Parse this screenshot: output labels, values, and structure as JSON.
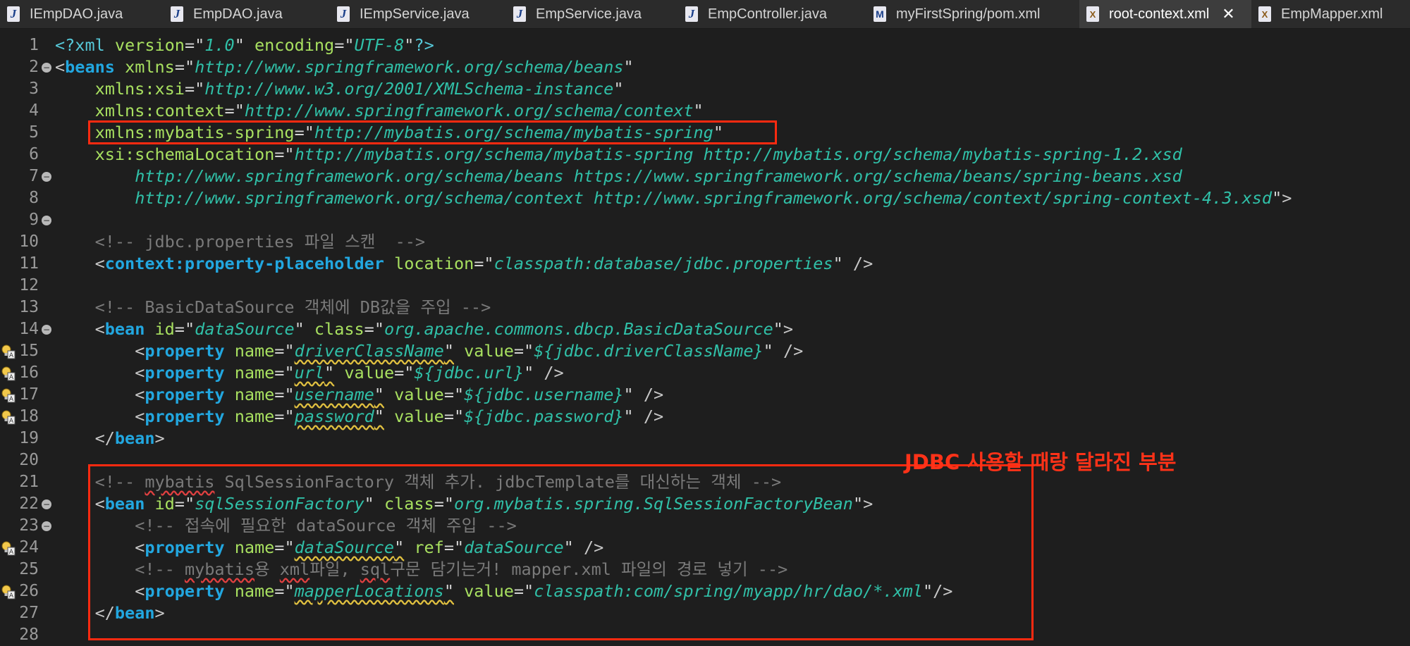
{
  "tabs": [
    {
      "label": "IEmpDAO.java",
      "icon": "java-file-icon",
      "active": false
    },
    {
      "label": "EmpDAO.java",
      "icon": "java-file-icon",
      "active": false
    },
    {
      "label": "IEmpService.java",
      "icon": "java-file-icon",
      "active": false
    },
    {
      "label": "EmpService.java",
      "icon": "java-file-icon",
      "active": false
    },
    {
      "label": "EmpController.java",
      "icon": "java-file-icon",
      "active": false
    },
    {
      "label": "myFirstSpring/pom.xml",
      "icon": "maven-file-icon",
      "active": false
    },
    {
      "label": "root-context.xml",
      "icon": "xml-file-icon",
      "active": true
    },
    {
      "label": "EmpMapper.xml",
      "icon": "xml-file-icon",
      "active": false
    }
  ],
  "annotation": "JDBC 사용할 때랑 달라진 부분",
  "colors": {
    "highlight_box": "#ff2a10",
    "annotation_text": "#ff3218",
    "editor_background": "#1e1e1e",
    "tag": "#22a7e0",
    "attribute": "#a8e060",
    "string": "#30c0a8",
    "comment": "#7a7a7a"
  },
  "lines": [
    {
      "num": "1",
      "fold": false,
      "warn": false,
      "tokens": [
        [
          "pi",
          "<?xml "
        ],
        [
          "attr",
          "version"
        ],
        [
          "eq",
          "="
        ],
        [
          "q",
          "\""
        ],
        [
          "str",
          "1.0"
        ],
        [
          "q",
          "\""
        ],
        [
          "t",
          " "
        ],
        [
          "attr",
          "encoding"
        ],
        [
          "eq",
          "="
        ],
        [
          "q",
          "\""
        ],
        [
          "str",
          "UTF-8"
        ],
        [
          "q",
          "\""
        ],
        [
          "pi",
          "?>"
        ]
      ]
    },
    {
      "num": "2",
      "fold": true,
      "warn": false,
      "tokens": [
        [
          "punct",
          "<"
        ],
        [
          "tag",
          "beans"
        ],
        [
          "t",
          " "
        ],
        [
          "attr",
          "xmlns"
        ],
        [
          "eq",
          "="
        ],
        [
          "q",
          "\""
        ],
        [
          "str",
          "http://www.springframework.org/schema/beans"
        ],
        [
          "q",
          "\""
        ]
      ]
    },
    {
      "num": "3",
      "fold": false,
      "warn": false,
      "tokens": [
        [
          "t",
          "    "
        ],
        [
          "attr",
          "xmlns:xsi"
        ],
        [
          "eq",
          "="
        ],
        [
          "q",
          "\""
        ],
        [
          "str",
          "http://www.w3.org/2001/XMLSchema-instance"
        ],
        [
          "q",
          "\""
        ]
      ]
    },
    {
      "num": "4",
      "fold": false,
      "warn": false,
      "tokens": [
        [
          "t",
          "    "
        ],
        [
          "attr",
          "xmlns:context"
        ],
        [
          "eq",
          "="
        ],
        [
          "q",
          "\""
        ],
        [
          "str",
          "http://www.springframework.org/schema/context"
        ],
        [
          "q",
          "\""
        ]
      ]
    },
    {
      "num": "5",
      "fold": false,
      "warn": false,
      "tokens": [
        [
          "t",
          "    "
        ],
        [
          "attr",
          "xmlns:mybatis-spring"
        ],
        [
          "eq",
          "="
        ],
        [
          "q",
          "\""
        ],
        [
          "str",
          "http://mybatis.org/schema/mybatis-spring"
        ],
        [
          "q",
          "\""
        ]
      ]
    },
    {
      "num": "6",
      "fold": false,
      "warn": false,
      "tokens": [
        [
          "t",
          "    "
        ],
        [
          "attr",
          "xsi:schemaLocation"
        ],
        [
          "eq",
          "="
        ],
        [
          "q",
          "\""
        ],
        [
          "str",
          "http://mybatis.org/schema/mybatis-spring http://mybatis.org/schema/mybatis-spring-1.2.xsd"
        ]
      ]
    },
    {
      "num": "7",
      "fold": true,
      "warn": false,
      "tokens": [
        [
          "t",
          "        "
        ],
        [
          "str",
          "http://www.springframework.org/schema/beans https://www.springframework.org/schema/beans/spring-beans.xsd"
        ]
      ]
    },
    {
      "num": "8",
      "fold": false,
      "warn": false,
      "tokens": [
        [
          "t",
          "        "
        ],
        [
          "str",
          "http://www.springframework.org/schema/context http://www.springframework.org/schema/context/spring-context-4.3.xsd"
        ],
        [
          "q",
          "\""
        ],
        [
          "punct",
          ">"
        ]
      ]
    },
    {
      "num": "9",
      "fold": true,
      "warn": false,
      "tokens": []
    },
    {
      "num": "10",
      "fold": false,
      "warn": false,
      "tokens": [
        [
          "t",
          "    "
        ],
        [
          "cmt",
          "<!-- jdbc.properties 파일 스캔  -->"
        ]
      ]
    },
    {
      "num": "11",
      "fold": false,
      "warn": false,
      "tokens": [
        [
          "t",
          "    "
        ],
        [
          "punct",
          "<"
        ],
        [
          "tag",
          "context:property-placeholder"
        ],
        [
          "t",
          " "
        ],
        [
          "attr",
          "location"
        ],
        [
          "eq",
          "="
        ],
        [
          "q",
          "\""
        ],
        [
          "str",
          "classpath:database/jdbc.properties"
        ],
        [
          "q",
          "\""
        ],
        [
          "t",
          " "
        ],
        [
          "punct",
          "/>"
        ]
      ]
    },
    {
      "num": "12",
      "fold": false,
      "warn": false,
      "tokens": []
    },
    {
      "num": "13",
      "fold": false,
      "warn": false,
      "tokens": [
        [
          "t",
          "    "
        ],
        [
          "cmt",
          "<!-- BasicDataSource 객체에 DB값을 주입 -->"
        ]
      ]
    },
    {
      "num": "14",
      "fold": true,
      "warn": false,
      "tokens": [
        [
          "t",
          "    "
        ],
        [
          "punct",
          "<"
        ],
        [
          "tag",
          "bean"
        ],
        [
          "t",
          " "
        ],
        [
          "attr",
          "id"
        ],
        [
          "eq",
          "="
        ],
        [
          "q",
          "\""
        ],
        [
          "str",
          "dataSource"
        ],
        [
          "q",
          "\""
        ],
        [
          "t",
          " "
        ],
        [
          "attr",
          "class"
        ],
        [
          "eq",
          "="
        ],
        [
          "q",
          "\""
        ],
        [
          "str",
          "org.apache.commons.dbcp.BasicDataSource"
        ],
        [
          "q",
          "\""
        ],
        [
          "punct",
          ">"
        ]
      ]
    },
    {
      "num": "15",
      "fold": false,
      "warn": true,
      "tokens": [
        [
          "t",
          "        "
        ],
        [
          "punct",
          "<"
        ],
        [
          "tag",
          "property"
        ],
        [
          "t",
          " "
        ],
        [
          "attr",
          "name"
        ],
        [
          "eq",
          "="
        ],
        [
          "q",
          "\""
        ],
        [
          "strU",
          "driverClassName"
        ],
        [
          "qU",
          "\""
        ],
        [
          "t",
          " "
        ],
        [
          "attr",
          "value"
        ],
        [
          "eq",
          "="
        ],
        [
          "q",
          "\""
        ],
        [
          "str",
          "${jdbc.driverClassName}"
        ],
        [
          "q",
          "\""
        ],
        [
          "t",
          " "
        ],
        [
          "punct",
          "/>"
        ]
      ]
    },
    {
      "num": "16",
      "fold": false,
      "warn": true,
      "tokens": [
        [
          "t",
          "        "
        ],
        [
          "punct",
          "<"
        ],
        [
          "tag",
          "property"
        ],
        [
          "t",
          " "
        ],
        [
          "attr",
          "name"
        ],
        [
          "eq",
          "="
        ],
        [
          "q",
          "\""
        ],
        [
          "strU",
          "url"
        ],
        [
          "qU",
          "\""
        ],
        [
          "t",
          " "
        ],
        [
          "attr",
          "value"
        ],
        [
          "eq",
          "="
        ],
        [
          "q",
          "\""
        ],
        [
          "str",
          "${jdbc.url}"
        ],
        [
          "q",
          "\""
        ],
        [
          "t",
          " "
        ],
        [
          "punct",
          "/>"
        ]
      ]
    },
    {
      "num": "17",
      "fold": false,
      "warn": true,
      "tokens": [
        [
          "t",
          "        "
        ],
        [
          "punct",
          "<"
        ],
        [
          "tag",
          "property"
        ],
        [
          "t",
          " "
        ],
        [
          "attr",
          "name"
        ],
        [
          "eq",
          "="
        ],
        [
          "q",
          "\""
        ],
        [
          "strU",
          "username"
        ],
        [
          "qU",
          "\""
        ],
        [
          "t",
          " "
        ],
        [
          "attr",
          "value"
        ],
        [
          "eq",
          "="
        ],
        [
          "q",
          "\""
        ],
        [
          "str",
          "${jdbc.username}"
        ],
        [
          "q",
          "\""
        ],
        [
          "t",
          " "
        ],
        [
          "punct",
          "/>"
        ]
      ]
    },
    {
      "num": "18",
      "fold": false,
      "warn": true,
      "tokens": [
        [
          "t",
          "        "
        ],
        [
          "punct",
          "<"
        ],
        [
          "tag",
          "property"
        ],
        [
          "t",
          " "
        ],
        [
          "attr",
          "name"
        ],
        [
          "eq",
          "="
        ],
        [
          "q",
          "\""
        ],
        [
          "strU",
          "password"
        ],
        [
          "qU",
          "\""
        ],
        [
          "t",
          " "
        ],
        [
          "attr",
          "value"
        ],
        [
          "eq",
          "="
        ],
        [
          "q",
          "\""
        ],
        [
          "str",
          "${jdbc.password}"
        ],
        [
          "q",
          "\""
        ],
        [
          "t",
          " "
        ],
        [
          "punct",
          "/>"
        ]
      ]
    },
    {
      "num": "19",
      "fold": false,
      "warn": false,
      "tokens": [
        [
          "t",
          "    "
        ],
        [
          "punct",
          "</"
        ],
        [
          "tag",
          "bean"
        ],
        [
          "punct",
          ">"
        ]
      ]
    },
    {
      "num": "20",
      "fold": false,
      "warn": false,
      "tokens": []
    },
    {
      "num": "21",
      "fold": false,
      "warn": false,
      "tokens": [
        [
          "t",
          "    "
        ],
        [
          "cmt",
          "<!-- "
        ],
        [
          "cmtS",
          "mybatis"
        ],
        [
          "cmt",
          " SqlSessionFactory 객체 추가. jdbcTemplate를 대신하는 객체 -->"
        ]
      ]
    },
    {
      "num": "22",
      "fold": true,
      "warn": false,
      "tokens": [
        [
          "t",
          "    "
        ],
        [
          "punct",
          "<"
        ],
        [
          "tag",
          "bean"
        ],
        [
          "t",
          " "
        ],
        [
          "attr",
          "id"
        ],
        [
          "eq",
          "="
        ],
        [
          "q",
          "\""
        ],
        [
          "str",
          "sqlSessionFactory"
        ],
        [
          "q",
          "\""
        ],
        [
          "t",
          " "
        ],
        [
          "attr",
          "class"
        ],
        [
          "eq",
          "="
        ],
        [
          "q",
          "\""
        ],
        [
          "str",
          "org.mybatis.spring.SqlSessionFactoryBean"
        ],
        [
          "q",
          "\""
        ],
        [
          "punct",
          ">"
        ]
      ]
    },
    {
      "num": "23",
      "fold": true,
      "warn": false,
      "tokens": [
        [
          "t",
          "        "
        ],
        [
          "cmt",
          "<!-- 접속에 필요한 dataSource 객체 주입 -->"
        ]
      ]
    },
    {
      "num": "24",
      "fold": false,
      "warn": true,
      "tokens": [
        [
          "t",
          "        "
        ],
        [
          "punct",
          "<"
        ],
        [
          "tag",
          "property"
        ],
        [
          "t",
          " "
        ],
        [
          "attr",
          "name"
        ],
        [
          "eq",
          "="
        ],
        [
          "q",
          "\""
        ],
        [
          "strU",
          "dataSource"
        ],
        [
          "qU",
          "\""
        ],
        [
          "t",
          " "
        ],
        [
          "attr",
          "ref"
        ],
        [
          "eq",
          "="
        ],
        [
          "q",
          "\""
        ],
        [
          "str",
          "dataSource"
        ],
        [
          "q",
          "\""
        ],
        [
          "t",
          " "
        ],
        [
          "punct",
          "/>"
        ]
      ]
    },
    {
      "num": "25",
      "fold": false,
      "warn": false,
      "tokens": [
        [
          "t",
          "        "
        ],
        [
          "cmt",
          "<!-- "
        ],
        [
          "cmtS",
          "mybatis"
        ],
        [
          "cmt",
          "용 "
        ],
        [
          "cmtS",
          "xml"
        ],
        [
          "cmt",
          "파일, "
        ],
        [
          "cmtS",
          "sql"
        ],
        [
          "cmt",
          "구문 담기는거! mapper.xml 파일의 경로 넣기 -->"
        ]
      ]
    },
    {
      "num": "26",
      "fold": false,
      "warn": true,
      "tokens": [
        [
          "t",
          "        "
        ],
        [
          "punct",
          "<"
        ],
        [
          "tag",
          "property"
        ],
        [
          "t",
          " "
        ],
        [
          "attr",
          "name"
        ],
        [
          "eq",
          "="
        ],
        [
          "q",
          "\""
        ],
        [
          "strU",
          "mapperLocations"
        ],
        [
          "qU",
          "\""
        ],
        [
          "t",
          " "
        ],
        [
          "attr",
          "value"
        ],
        [
          "eq",
          "="
        ],
        [
          "q",
          "\""
        ],
        [
          "str",
          "classpath:com/spring/myapp/hr/dao/*.xml"
        ],
        [
          "q",
          "\""
        ],
        [
          "punct",
          "/>"
        ]
      ]
    },
    {
      "num": "27",
      "fold": false,
      "warn": false,
      "tokens": [
        [
          "t",
          "    "
        ],
        [
          "punct",
          "</"
        ],
        [
          "tag",
          "bean"
        ],
        [
          "punct",
          ">"
        ]
      ]
    },
    {
      "num": "28",
      "fold": false,
      "warn": false,
      "tokens": []
    }
  ]
}
